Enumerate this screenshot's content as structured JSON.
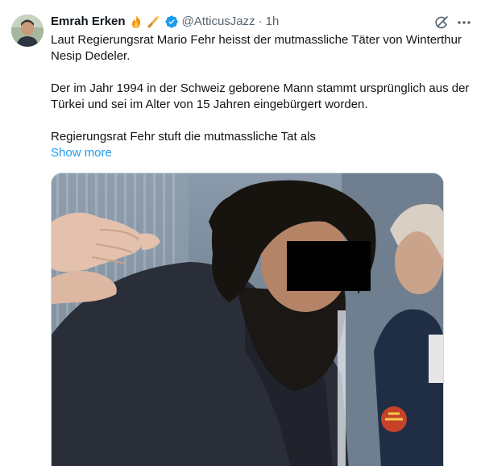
{
  "tweet": {
    "author": {
      "display_name": "Emrah Erken",
      "badge_emojis": [
        "fire-emoji",
        "sparkle-wand-emoji"
      ],
      "verified": true,
      "handle": "@AtticusJazz",
      "separator": "·",
      "time": "1h"
    },
    "paragraphs": [
      "Laut Regierungsrat Mario Fehr heisst der mutmassliche Täter von Winterthur Nesip Dedeler.",
      "Der im Jahr 1994 in der Schweiz geborene Mann stammt ursprünglich aus der Türkei und sei im Alter von 15 Jahren eingebürgert worden.",
      "Regierungsrat Fehr stuft die mutmassliche Tat als"
    ],
    "show_more": "Show more",
    "actions": {
      "grok_icon": "grok-icon",
      "more_icon": "more-icon"
    },
    "media": {
      "type": "photo",
      "censor_bar": true
    }
  },
  "colors": {
    "text": "#0f1419",
    "secondary": "#536471",
    "link": "#1d9bf0",
    "verified": "#1d9bf0"
  }
}
